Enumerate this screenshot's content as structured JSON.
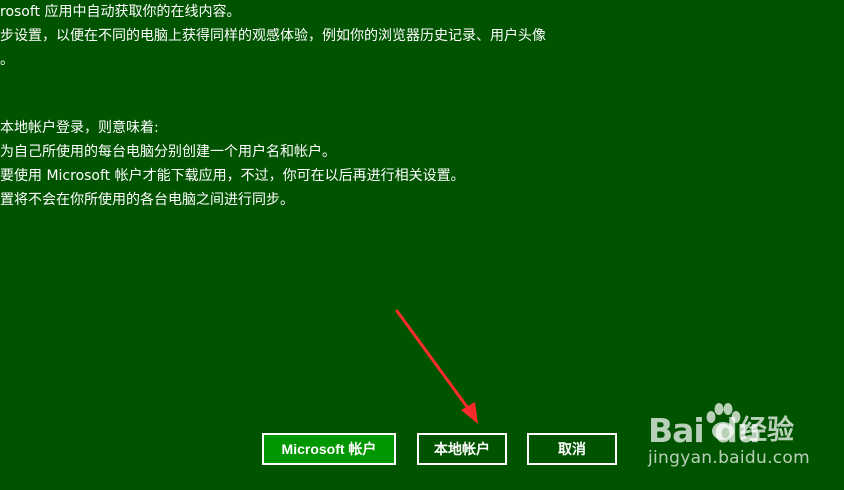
{
  "intro_lines": [
    "rosoft 应用中自动获取你的在线内容。",
    "步设置，以便在不同的电脑上获得同样的观感体验，例如你的浏览器历史记录、用户头像",
    "。"
  ],
  "local_account_lines": [
    "本地帐户登录，则意味着:",
    "为自己所使用的每台电脑分别创建一个用户名和帐户。",
    "要使用 Microsoft 帐户才能下载应用，不过，你可在以后再进行相关设置。",
    "置将不会在你所使用的各台电脑之间进行同步。"
  ],
  "buttons": {
    "microsoft_account": "Microsoft 帐户",
    "local_account": "本地帐户",
    "cancel": "取消"
  },
  "colors": {
    "background": "#005400",
    "primary_button": "#009600",
    "arrow": "#ff2a2a"
  },
  "watermark": {
    "logo": "Bai du",
    "brand": "经验",
    "url": "jingyan.baidu.com"
  }
}
